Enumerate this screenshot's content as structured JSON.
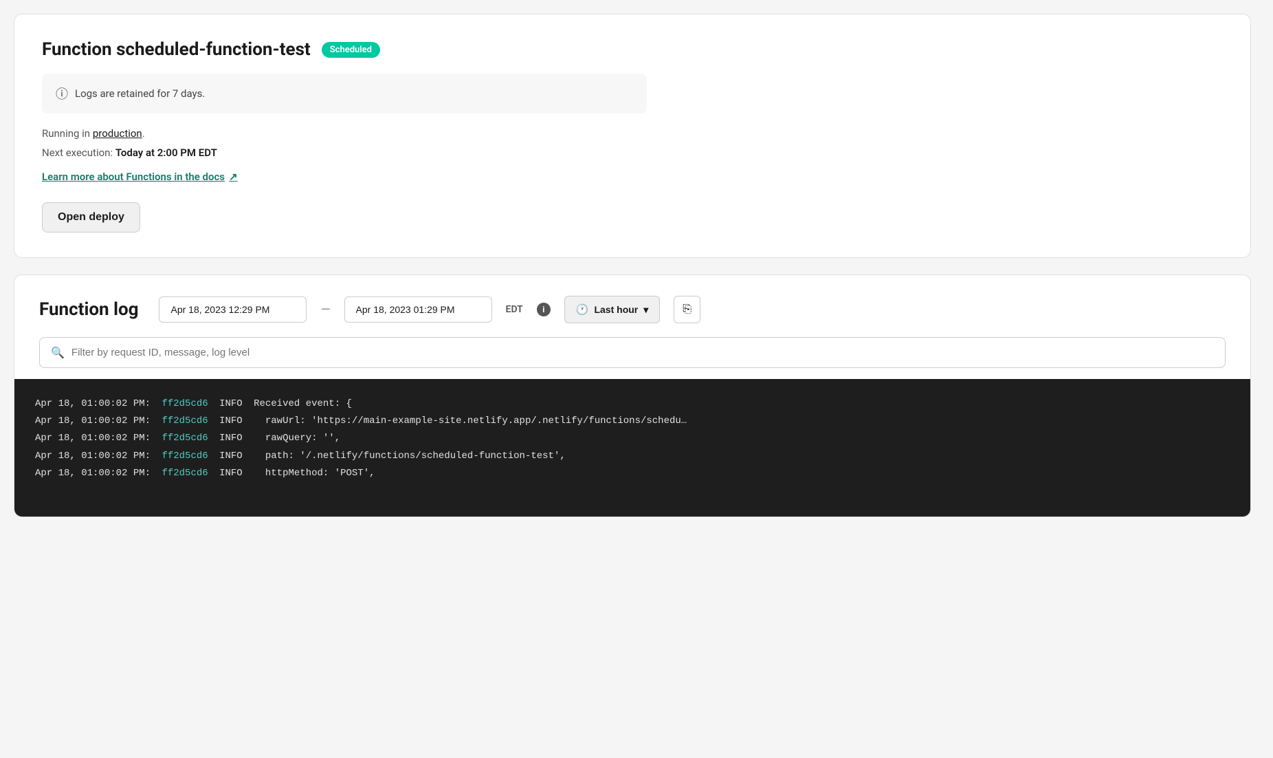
{
  "topCard": {
    "title": "Function scheduled-function-test",
    "badge": "Scheduled",
    "infoMessage": "Logs are retained for 7 days.",
    "runningText": "Running in",
    "runningLink": "production",
    "runningPeriod": ".",
    "nextExecLabel": "Next execution:",
    "nextExecValue": "Today at 2:00 PM EDT",
    "docsLinkText": "Learn more about Functions in the docs",
    "docsLinkIcon": "↗",
    "openDeployLabel": "Open deploy"
  },
  "logCard": {
    "title": "Function log",
    "startDate": "Apr 18, 2023 12:29 PM",
    "endDate": "Apr 18, 2023 01:29 PM",
    "timezone": "EDT",
    "lastHour": "Last hour",
    "filterPlaceholder": "Filter by request ID, message, log level",
    "exportIcon": "⊞",
    "logs": [
      {
        "date": "Apr 18, 01:00:02 PM:",
        "id": "ff2d5cd6",
        "level": "INFO",
        "message": "Received event: {"
      },
      {
        "date": "Apr 18, 01:00:02 PM:",
        "id": "ff2d5cd6",
        "level": "INFO",
        "message": "  rawUrl: 'https://main-example-site.netlify.app/.netlify/functions/schedu…"
      },
      {
        "date": "Apr 18, 01:00:02 PM:",
        "id": "ff2d5cd6",
        "level": "INFO",
        "message": "  rawQuery: '',"
      },
      {
        "date": "Apr 18, 01:00:02 PM:",
        "id": "ff2d5cd6",
        "level": "INFO",
        "message": "  path: '/.netlify/functions/scheduled-function-test',"
      },
      {
        "date": "Apr 18, 01:00:02 PM:",
        "id": "ff2d5cd6",
        "level": "INFO",
        "message": "  httpMethod: 'POST',"
      }
    ]
  }
}
